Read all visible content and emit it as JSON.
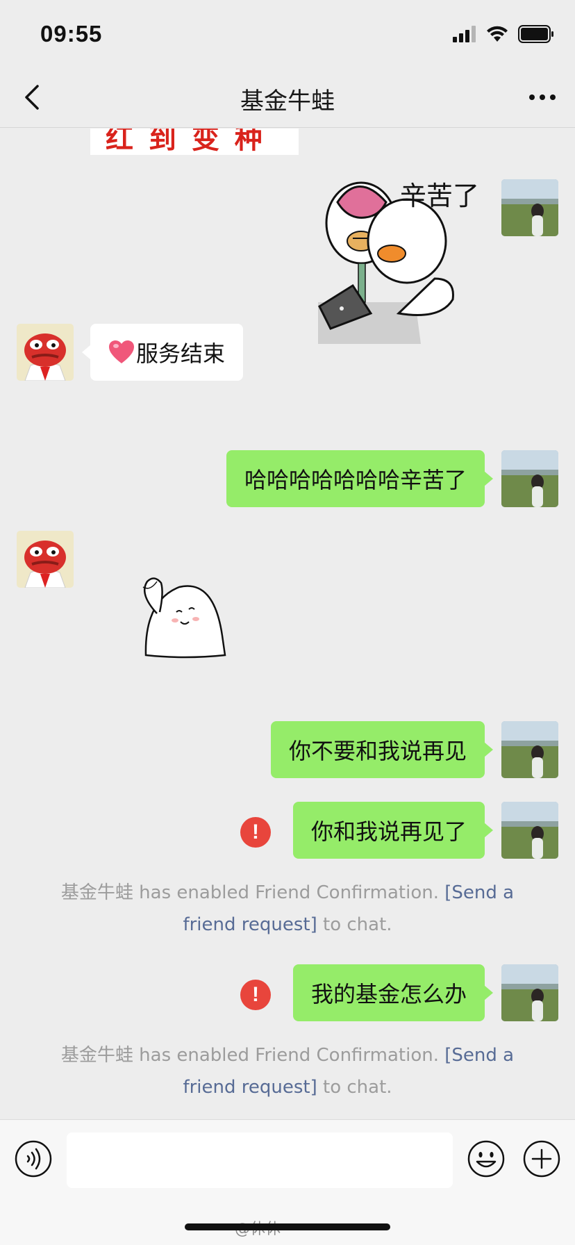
{
  "status_bar": {
    "time": "09:55"
  },
  "nav": {
    "title": "基金牛蛙"
  },
  "partial_sticker": {
    "text": "红 到 变 种"
  },
  "stickers": {
    "sticker_tired_text": "辛苦了"
  },
  "messages": [
    {
      "id": "m1",
      "direction": "received",
      "emoji": "heart",
      "text": "服务结束"
    },
    {
      "id": "m2",
      "direction": "sent",
      "text": "哈哈哈哈哈哈哈辛苦了"
    },
    {
      "id": "m3",
      "direction": "sent",
      "text": "你不要和我说再见"
    },
    {
      "id": "m4",
      "direction": "sent",
      "status": "failed",
      "text": "你和我说再见了"
    },
    {
      "id": "m5",
      "direction": "sent",
      "status": "failed",
      "text": "我的基金怎么办"
    }
  ],
  "system_notice": {
    "name": "基金牛蛙",
    "text_before": " has enabled Friend Confirmation. ",
    "link": "[Send a friend request]",
    "text_after": " to chat."
  },
  "input_bar": {
    "placeholder": ""
  },
  "watermark": "@休休",
  "colors": {
    "background": "#ededed",
    "sent_bubble": "#95ec69",
    "received_bubble": "#ffffff",
    "error": "#e8453c",
    "link": "#576b95",
    "system_text": "#9c9c9c"
  }
}
